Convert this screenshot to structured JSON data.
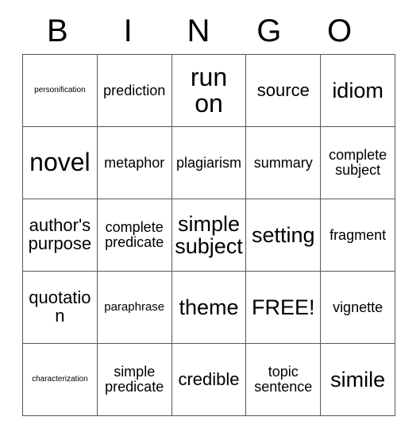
{
  "card": {
    "header_letters": [
      "B",
      "I",
      "N",
      "G",
      "O"
    ],
    "free_space_label": "FREE!",
    "grid": [
      [
        {
          "text": "personification",
          "size": "fs-xxs"
        },
        {
          "text": "prediction",
          "size": "fs-md"
        },
        {
          "text": "run on",
          "size": "fs-xxl"
        },
        {
          "text": "source",
          "size": "fs-lg"
        },
        {
          "text": "idiom",
          "size": "fs-xl"
        }
      ],
      [
        {
          "text": "novel",
          "size": "fs-xxl"
        },
        {
          "text": "metaphor",
          "size": "fs-md"
        },
        {
          "text": "plagiarism",
          "size": "fs-md"
        },
        {
          "text": "summary",
          "size": "fs-md"
        },
        {
          "text": "complete subject",
          "size": "fs-md"
        }
      ],
      [
        {
          "text": "author's purpose",
          "size": "fs-lg"
        },
        {
          "text": "complete predicate",
          "size": "fs-md"
        },
        {
          "text": "simple subject",
          "size": "fs-xl"
        },
        {
          "text": "setting",
          "size": "fs-xl"
        },
        {
          "text": "fragment",
          "size": "fs-md"
        }
      ],
      [
        {
          "text": "quotation",
          "size": "fs-lg"
        },
        {
          "text": "paraphrase",
          "size": "fs-sm"
        },
        {
          "text": "theme",
          "size": "fs-xl"
        },
        {
          "text": "FREE!",
          "size": "fs-xl"
        },
        {
          "text": "vignette",
          "size": "fs-md"
        }
      ],
      [
        {
          "text": "characterization",
          "size": "fs-xxs"
        },
        {
          "text": "simple predicate",
          "size": "fs-md"
        },
        {
          "text": "credible",
          "size": "fs-lg"
        },
        {
          "text": "topic sentence",
          "size": "fs-md"
        },
        {
          "text": "simile",
          "size": "fs-xl"
        }
      ]
    ]
  },
  "colors": {
    "background": "#ffffff",
    "text": "#000000",
    "grid_line": "#575757"
  }
}
